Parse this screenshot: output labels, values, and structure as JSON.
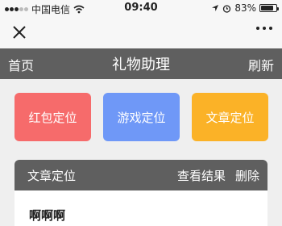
{
  "status_bar": {
    "carrier": "中国电信",
    "time": "09:40",
    "battery": "83%",
    "battery_level": 0.83
  },
  "header": {
    "home": "首页",
    "title": "礼物助理",
    "refresh": "刷新"
  },
  "buttons": [
    {
      "label": "红包定位",
      "color": "#f66b6b"
    },
    {
      "label": "游戏定位",
      "color": "#6f98f7"
    },
    {
      "label": "文章定位",
      "color": "#fbb227"
    }
  ],
  "card": {
    "title": "文章定位",
    "view_results": "查看结果",
    "delete": "删除",
    "content": "啊啊啊"
  },
  "icons": {
    "signal": "signal-icon",
    "wifi": "wifi-icon",
    "location": "location-arrow-icon",
    "alarm": "alarm-icon",
    "battery": "battery-icon",
    "close": "close-icon",
    "more": "more-dots-icon"
  }
}
